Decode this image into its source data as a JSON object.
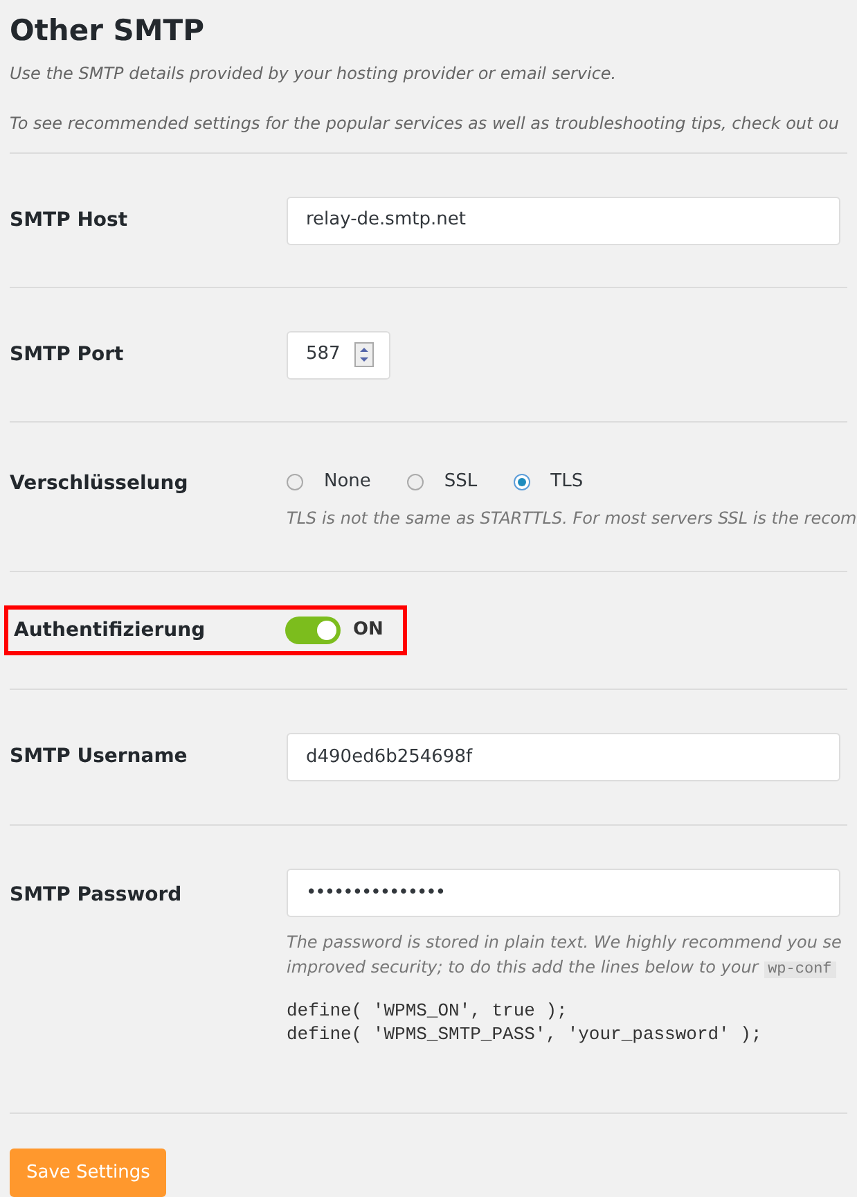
{
  "title": "Other SMTP",
  "intro": [
    "Use the SMTP details provided by your hosting provider or email service.",
    "To see recommended settings for the popular services as well as troubleshooting tips, check out ou"
  ],
  "host": {
    "label": "SMTP Host",
    "value": "relay-de.smtp.net"
  },
  "port": {
    "label": "SMTP Port",
    "value": "587"
  },
  "encryption": {
    "label": "Verschlüsselung",
    "options": [
      {
        "label": "None",
        "selected": false
      },
      {
        "label": "SSL",
        "selected": false
      },
      {
        "label": "TLS",
        "selected": true
      }
    ],
    "description": "TLS is not the same as STARTTLS. For most servers SSL is the recom"
  },
  "auth": {
    "label": "Authentifizierung",
    "on": true,
    "state_text": "ON",
    "highlighted": true
  },
  "username": {
    "label": "SMTP Username",
    "value": "d490ed6b254698f"
  },
  "password": {
    "label": "SMTP Password",
    "value": "•••••••••••••••",
    "description_lines": [
      "The password is stored in plain text. We highly recommend you se",
      "improved security; to do this add the lines below to your"
    ],
    "inline_code": "wp-conf",
    "code_lines": [
      "define( 'WPMS_ON', true );",
      "define( 'WPMS_SMTP_PASS', 'your_password' );"
    ]
  },
  "save_button": "Save Settings"
}
